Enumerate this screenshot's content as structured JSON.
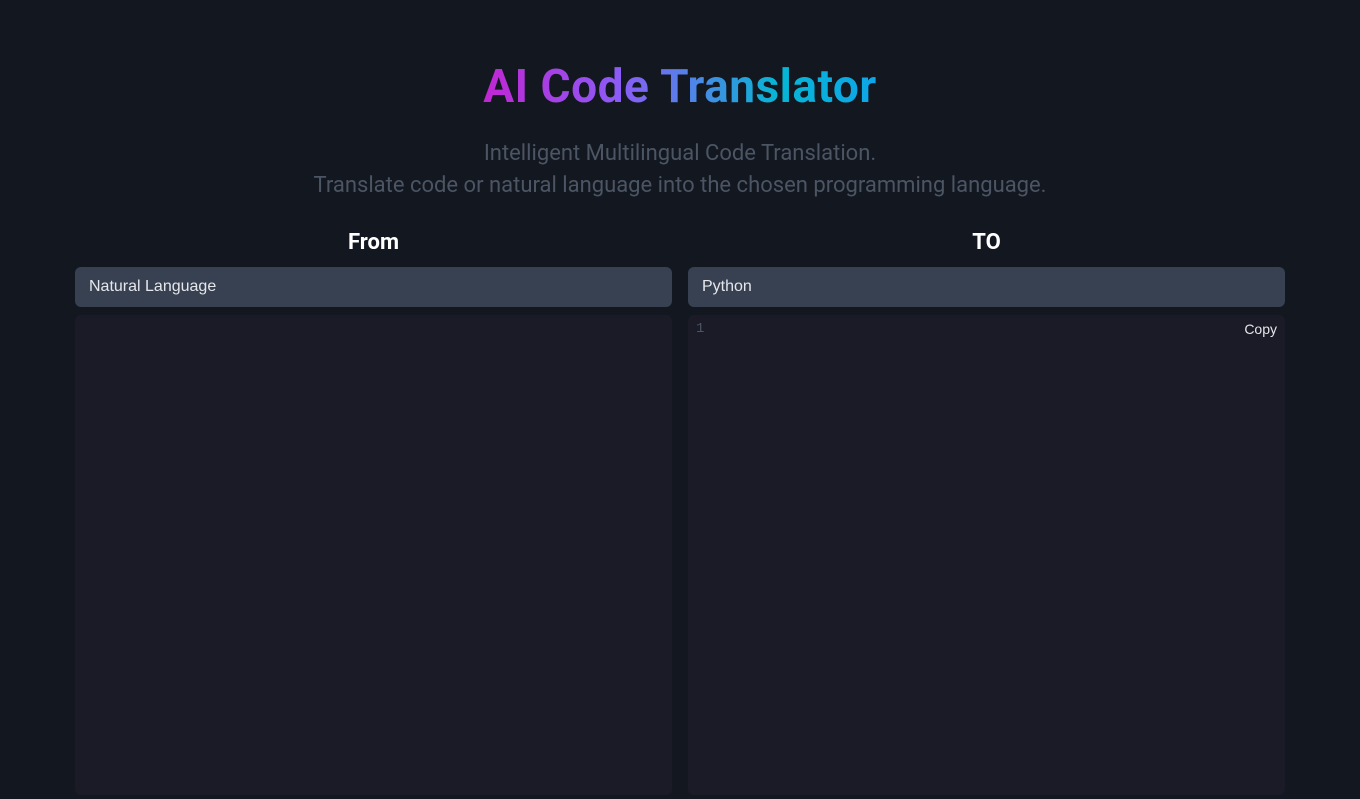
{
  "header": {
    "title": "AI Code Translator",
    "subtitle_line1": "Intelligent Multilingual Code Translation.",
    "subtitle_line2": "Translate code or natural language into the chosen programming language."
  },
  "from": {
    "label": "From",
    "selected": "Natural Language",
    "content": ""
  },
  "to": {
    "label": "TO",
    "selected": "Python",
    "line_number": "1",
    "copy_label": "Copy",
    "content": ""
  }
}
